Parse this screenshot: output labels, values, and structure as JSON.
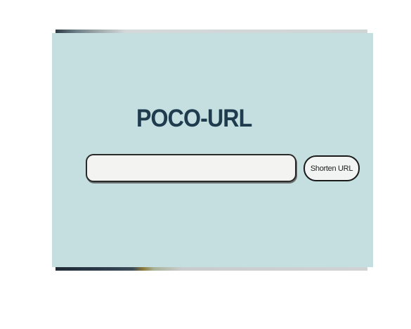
{
  "app": {
    "title": "POCO-URL"
  },
  "form": {
    "url_input": {
      "value": "",
      "placeholder": ""
    },
    "shorten_button_label": "Shorten URL"
  },
  "colors": {
    "card_background": "#c5dfe1",
    "title_color": "#1f3b4e",
    "input_background": "#f3f3f1",
    "button_background": "#f1f4f3"
  }
}
